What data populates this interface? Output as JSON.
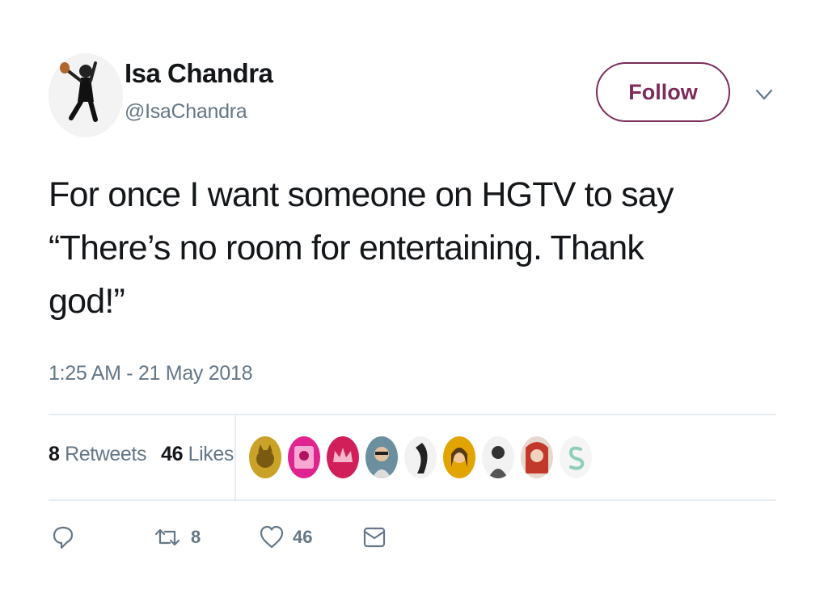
{
  "tweet": {
    "display_name": "Isa Chandra",
    "handle": "@IsaChandra",
    "follow_label": "Follow",
    "text_lines": [
      "For once I want someone on HGTV to say",
      "“There’s no room for entertaining. Thank",
      "god!”"
    ],
    "timestamp": "1:25 AM - 21 May 2018"
  },
  "stats": {
    "retweets_count": "8",
    "retweets_label": "Retweets",
    "likes_count": "46",
    "likes_label": "Likes"
  },
  "likers": [
    {
      "icon": "cat-avatar",
      "color": "#c9a227"
    },
    {
      "icon": "pink-portrait-avatar",
      "color": "#e0248f"
    },
    {
      "icon": "crown-avatar",
      "color": "#d11f5a"
    },
    {
      "icon": "sunglasses-avatar",
      "color": "#6b8f9e"
    },
    {
      "icon": "silhouette-avatar",
      "color": "#222222"
    },
    {
      "icon": "woman-yellow-avatar",
      "color": "#e1a400"
    },
    {
      "icon": "monochrome-avatar",
      "color": "#555555"
    },
    {
      "icon": "redhead-avatar",
      "color": "#c0392b"
    },
    {
      "icon": "letter-s-avatar",
      "color": "#8fcfb8"
    }
  ],
  "actions": {
    "reply": {
      "icon": "reply-icon"
    },
    "retweet": {
      "icon": "retweet-icon",
      "count": "8"
    },
    "like": {
      "icon": "heart-icon",
      "count": "46"
    },
    "message": {
      "icon": "envelope-icon"
    }
  },
  "colors": {
    "accent": "#7b2c59",
    "text": "#14171a",
    "muted": "#657786",
    "divider": "#e6ecf0"
  }
}
